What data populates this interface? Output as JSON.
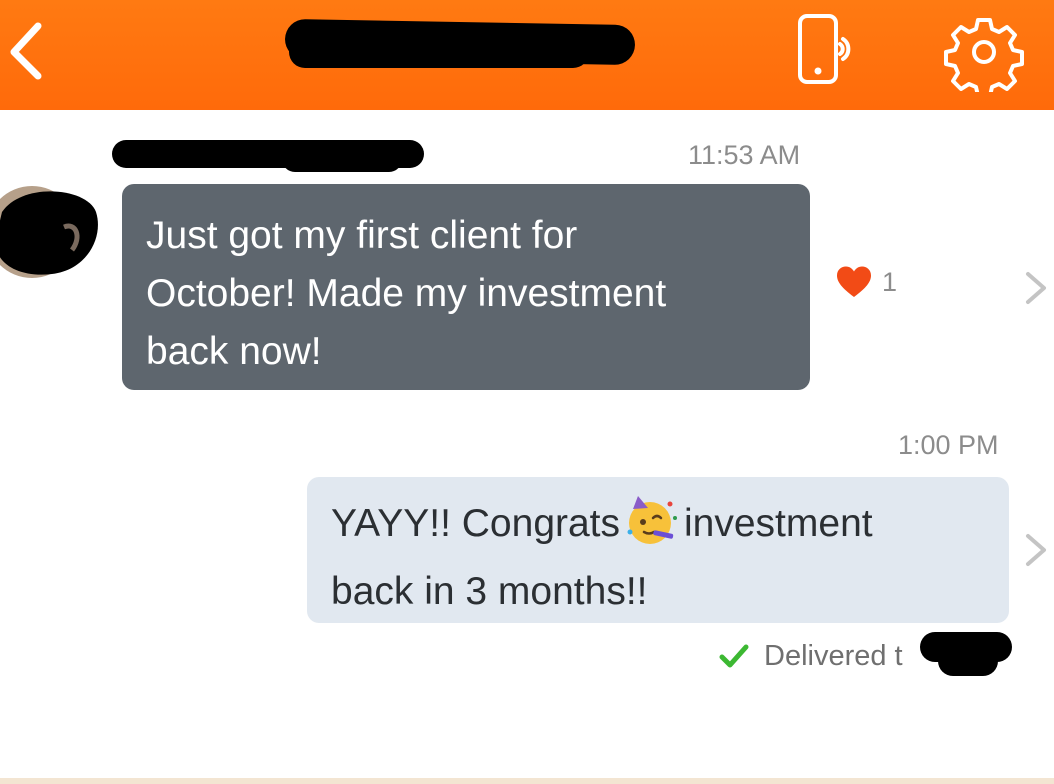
{
  "header": {
    "back_icon": "chevron-left-icon",
    "call_icon": "phone-speaker-icon",
    "settings_icon": "gear-icon",
    "background": "#ff6a0a"
  },
  "messages": [
    {
      "direction": "incoming",
      "time": "11:53 AM",
      "text": "Just got my first client for\nOctober! Made my investment\nback now!",
      "reaction": {
        "icon": "heart-icon",
        "count": "1",
        "color": "#f24b16"
      }
    },
    {
      "direction": "outgoing",
      "time": "1:00 PM",
      "text_before": "YAYY!! Congrats",
      "emoji": "partying-face-emoji",
      "text_after": "investment\nback in 3 months!!",
      "status": "Delivered t"
    }
  ],
  "colors": {
    "incoming_bubble": "#5e666e",
    "outgoing_bubble": "#e1e8f0",
    "delivered_check": "#3cb832"
  }
}
